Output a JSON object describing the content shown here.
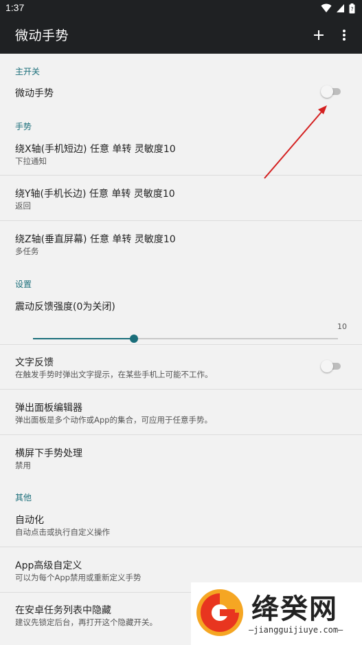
{
  "status_bar": {
    "time": "1:37",
    "icons": [
      "wifi-icon",
      "signal-icon",
      "battery-icon"
    ]
  },
  "app_bar": {
    "title": "微动手势",
    "actions": [
      "add-icon",
      "more-vert-icon"
    ]
  },
  "sections": {
    "main_switch": {
      "header": "主开关",
      "toggle_label": "微动手势",
      "toggle_on": false
    },
    "gestures": {
      "header": "手势",
      "items": [
        {
          "title": "绕X轴(手机短边) 任意 单转 灵敏度10",
          "subtitle": "下拉通知"
        },
        {
          "title": "绕Y轴(手机长边) 任意 单转 灵敏度10",
          "subtitle": "返回"
        },
        {
          "title": "绕Z轴(垂直屏幕) 任意 单转 灵敏度10",
          "subtitle": "多任务"
        }
      ]
    },
    "settings": {
      "header": "设置",
      "vibration": {
        "title": "震动反馈强度(0为关闭)",
        "value": 10,
        "value_label": "10",
        "slider_fraction": 0.33
      },
      "text_feedback": {
        "title": "文字反馈",
        "subtitle": "在触发手势时弹出文字提示，在某些手机上可能不工作。",
        "toggle_on": false
      },
      "popup_editor": {
        "title": "弹出面板编辑器",
        "subtitle": "弹出面板是多个动作或App的集合，可应用于任意手势。"
      },
      "landscape": {
        "title": "横屏下手势处理",
        "subtitle": "禁用"
      }
    },
    "other": {
      "header": "其他",
      "items": [
        {
          "title": "自动化",
          "subtitle": "自动点击或执行自定义操作"
        },
        {
          "title": "App高级自定义",
          "subtitle": "可以为每个App禁用或重新定义手势"
        },
        {
          "title": "在安卓任务列表中隐藏",
          "subtitle": "建议先锁定后台，再打开这个隐藏开关。"
        }
      ]
    }
  },
  "watermark": {
    "text": "绛癸网",
    "url": "—jiangguijiuye.com—"
  },
  "colors": {
    "app_bar_bg": "#1f2123",
    "accent": "#1a6e7a",
    "background": "#f2f2f2",
    "annotation_arrow": "#d42020"
  }
}
